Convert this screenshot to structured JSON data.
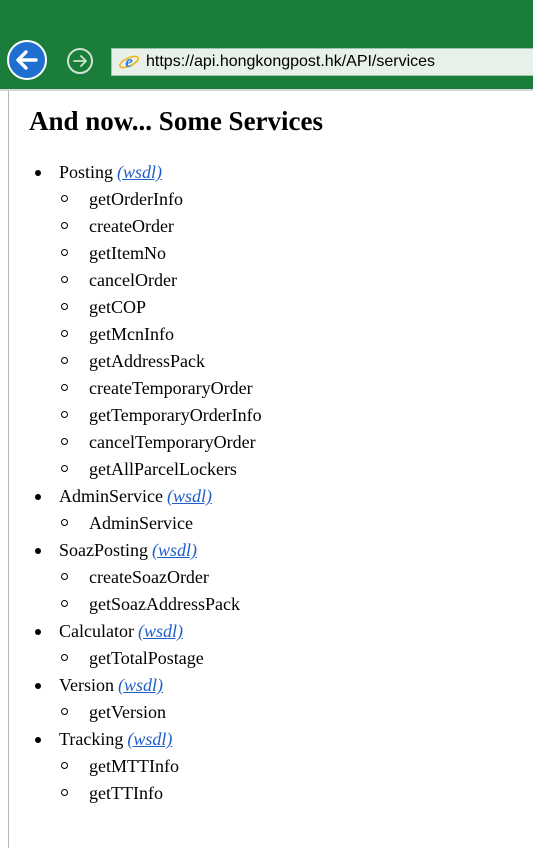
{
  "browser": {
    "url": "https://api.hongkongpost.hk/API/services"
  },
  "page": {
    "title": "And now... Some Services",
    "wsdl_label": "(wsdl)",
    "services": [
      {
        "name": "Posting",
        "methods": [
          "getOrderInfo",
          "createOrder",
          "getItemNo",
          "cancelOrder",
          "getCOP",
          "getMcnInfo",
          "getAddressPack",
          "createTemporaryOrder",
          "getTemporaryOrderInfo",
          "cancelTemporaryOrder",
          "getAllParcelLockers"
        ]
      },
      {
        "name": "AdminService",
        "methods": [
          "AdminService"
        ]
      },
      {
        "name": "SoazPosting",
        "methods": [
          "createSoazOrder",
          "getSoazAddressPack"
        ]
      },
      {
        "name": "Calculator",
        "methods": [
          "getTotalPostage"
        ]
      },
      {
        "name": "Version",
        "methods": [
          "getVersion"
        ]
      },
      {
        "name": "Tracking",
        "methods": [
          "getMTTInfo",
          "getTTInfo"
        ]
      }
    ]
  },
  "colors": {
    "chrome": "#1b7d3a",
    "back_button": "#1f6fd0",
    "link": "#1f5fc8"
  }
}
